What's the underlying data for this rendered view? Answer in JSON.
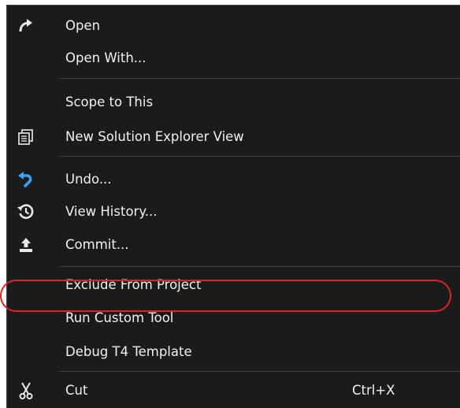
{
  "context_menu": {
    "items": [
      {
        "label": "Open",
        "icon": "open-arrow-icon"
      },
      {
        "label": "Open With...",
        "icon": ""
      },
      {
        "label": "Scope to This",
        "icon": ""
      },
      {
        "label": "New Solution Explorer View",
        "icon": "solution-explorer-view-icon"
      },
      {
        "label": "Undo...",
        "icon": "undo-icon"
      },
      {
        "label": "View History...",
        "icon": "history-icon"
      },
      {
        "label": "Commit...",
        "icon": "commit-icon"
      },
      {
        "label": "Exclude From Project",
        "icon": ""
      },
      {
        "label": "Run Custom Tool",
        "icon": "",
        "highlighted": true
      },
      {
        "label": "Debug T4 Template",
        "icon": ""
      },
      {
        "label": "Cut",
        "icon": "cut-icon",
        "shortcut": "Ctrl+X"
      }
    ]
  },
  "colors": {
    "menu_background": "#1b1b1c",
    "text": "#f1f1f1",
    "separator": "#3f3f46",
    "undo_icon": "#3ba3f7",
    "highlight_ring": "#d42626"
  }
}
